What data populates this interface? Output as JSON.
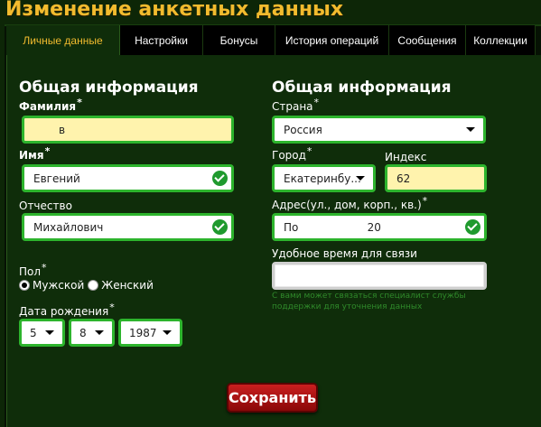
{
  "page_title": "Изменение анкетных данных",
  "tabs": [
    {
      "label": "Личные данные",
      "active": true
    },
    {
      "label": "Настройки"
    },
    {
      "label": "Бонусы"
    },
    {
      "label": "История операций"
    },
    {
      "label": "Сообщения"
    },
    {
      "label": "Коллекции"
    }
  ],
  "left": {
    "section_title": "Общая информация",
    "surname": {
      "label": "Фамилия",
      "value": "в"
    },
    "name": {
      "label": "Имя",
      "value": "Евгений"
    },
    "patronymic": {
      "label": "Отчество",
      "value": "Михайлович"
    },
    "gender": {
      "label": "Пол",
      "option_male": "Мужской",
      "option_female": "Женский",
      "selected": "Мужской"
    },
    "birthdate": {
      "label": "Дата рождения",
      "day": "5",
      "month": "8",
      "year": "1987"
    }
  },
  "right": {
    "section_title": "Общая информация",
    "country": {
      "label": "Страна",
      "value": "Россия"
    },
    "city": {
      "label": "Город",
      "value": "Екатеринбу..."
    },
    "index": {
      "label": "Индекс",
      "value": "62"
    },
    "address": {
      "label": "Адрес(ул., дом, корп., кв.)",
      "value": "По                    20"
    },
    "contact_time": {
      "label": "Удобное время для связи",
      "value": ""
    },
    "hint": "С вами может связаться специалист службы поддержки для уточнения данных"
  },
  "required_mark": "*",
  "save_label": "Сохранить",
  "colors": {
    "accent": "#f2bb2e",
    "valid_border": "#2db42d",
    "button": "#b01414",
    "panel": "#0f2d0a"
  }
}
